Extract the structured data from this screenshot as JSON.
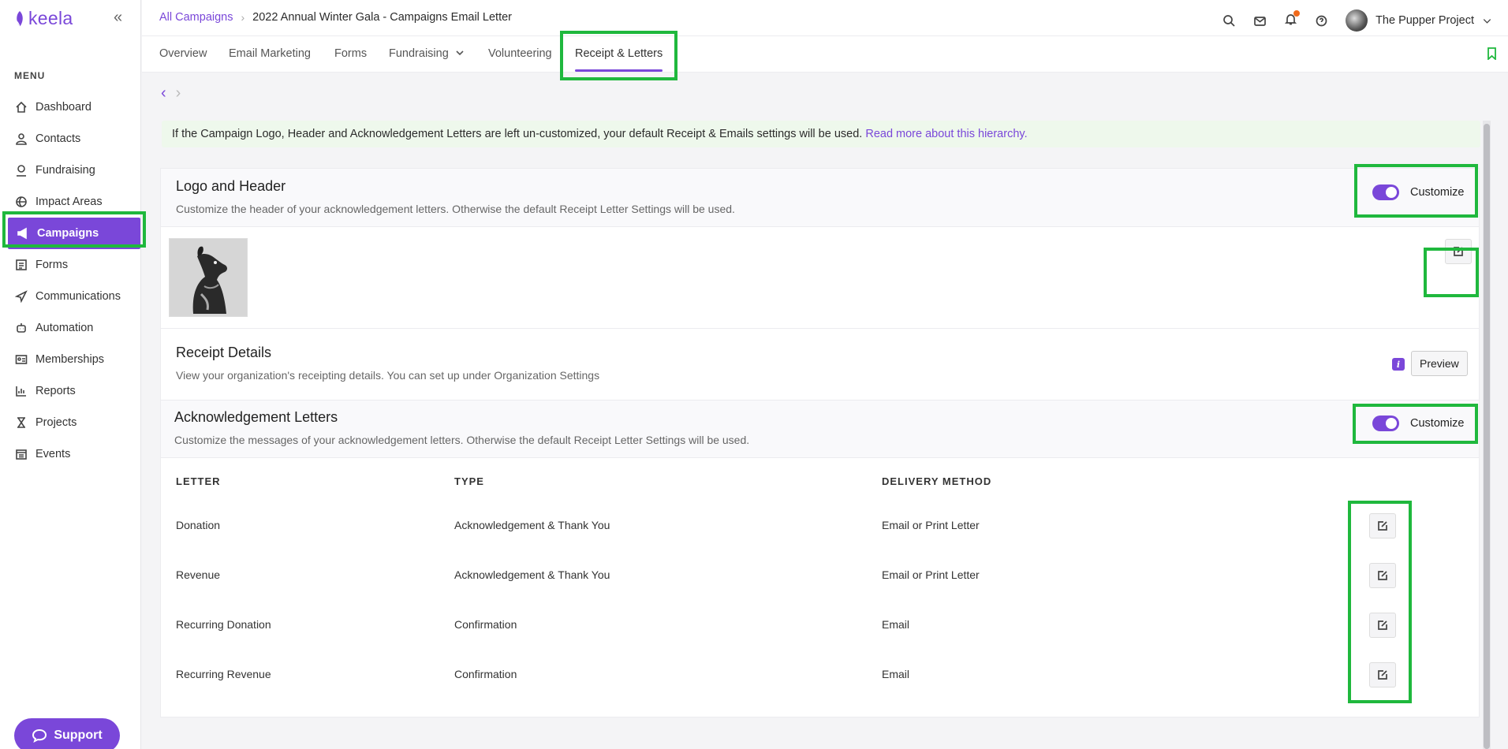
{
  "app": {
    "logo_text": "keela"
  },
  "sidebar": {
    "menu_label": "MENU",
    "items": [
      {
        "label": "Dashboard",
        "icon": "home-icon"
      },
      {
        "label": "Contacts",
        "icon": "user-icon"
      },
      {
        "label": "Fundraising",
        "icon": "donation-icon"
      },
      {
        "label": "Impact Areas",
        "icon": "globe-icon"
      },
      {
        "label": "Campaigns",
        "icon": "megaphone-icon",
        "active": true
      },
      {
        "label": "Forms",
        "icon": "form-icon"
      },
      {
        "label": "Communications",
        "icon": "paper-plane-icon"
      },
      {
        "label": "Automation",
        "icon": "robot-icon"
      },
      {
        "label": "Memberships",
        "icon": "id-card-icon"
      },
      {
        "label": "Reports",
        "icon": "bar-chart-icon"
      },
      {
        "label": "Projects",
        "icon": "hourglass-icon"
      },
      {
        "label": "Events",
        "icon": "calendar-icon"
      }
    ],
    "support_label": "Support"
  },
  "header": {
    "breadcrumb_root": "All Campaigns",
    "breadcrumb_current": "2022 Annual Winter Gala - Campaigns Email Letter",
    "org_name": "The Pupper Project"
  },
  "tabs": [
    {
      "label": "Overview"
    },
    {
      "label": "Email Marketing"
    },
    {
      "label": "Forms"
    },
    {
      "label": "Fundraising"
    },
    {
      "label": "Volunteering"
    },
    {
      "label": "Receipt & Letters",
      "active": true
    }
  ],
  "notice": {
    "text": "If the Campaign Logo, Header and Acknowledgement Letters are left un-customized, your default Receipt & Emails settings will be used.",
    "link": "Read more about this hierarchy."
  },
  "logo_header": {
    "title": "Logo and Header",
    "description": "Customize the header of your acknowledgement letters. Otherwise the default Receipt Letter Settings will be used.",
    "toggle_label": "Customize"
  },
  "receipt_details": {
    "title": "Receipt Details",
    "description": "View your organization's receipting details. You can set up under Organization Settings",
    "info_badge": "i",
    "preview_label": "Preview"
  },
  "ack_letters": {
    "title": "Acknowledgement Letters",
    "description": "Customize the messages of your acknowledgement letters. Otherwise the default Receipt Letter Settings will be used.",
    "toggle_label": "Customize",
    "columns": [
      "LETTER",
      "TYPE",
      "DELIVERY METHOD"
    ],
    "rows": [
      [
        "Donation",
        "Acknowledgement & Thank You",
        "Email or Print Letter"
      ],
      [
        "Revenue",
        "Acknowledgement & Thank You",
        "Email or Print Letter"
      ],
      [
        "Recurring Donation",
        "Confirmation",
        "Email"
      ],
      [
        "Recurring Revenue",
        "Confirmation",
        "Email"
      ]
    ]
  },
  "colors": {
    "accent": "#7a47d9",
    "highlight": "#1fb83d",
    "notice_bg": "#eef8ec"
  }
}
